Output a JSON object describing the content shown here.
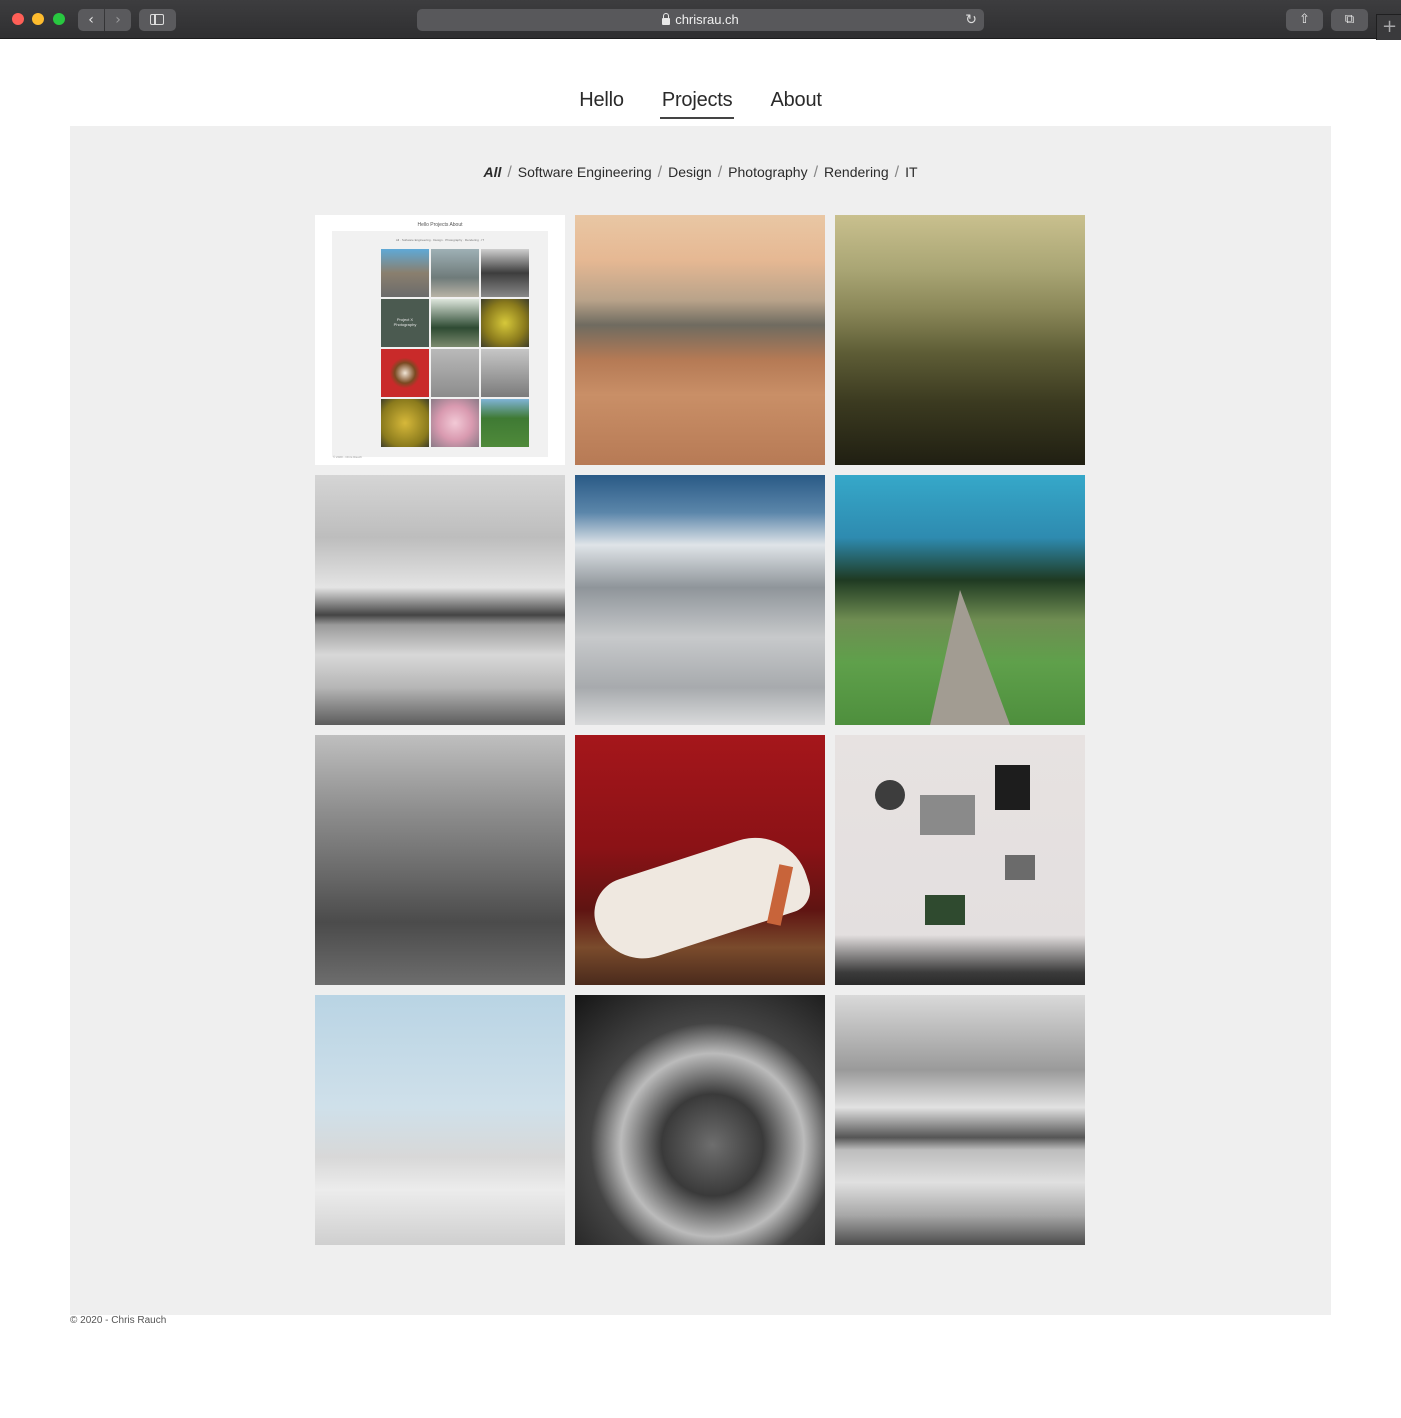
{
  "browser": {
    "url": "chrisrau.ch",
    "back_icon": "‹",
    "forward_icon": "›",
    "reload_icon": "↻",
    "share_icon": "⇧",
    "tabs_icon": "⧉",
    "newtab_icon": "+"
  },
  "nav": {
    "items": [
      {
        "label": "Hello"
      },
      {
        "label": "Projects",
        "active": true
      },
      {
        "label": "About"
      }
    ]
  },
  "filters": [
    {
      "label": "All",
      "active": true
    },
    {
      "label": "Software Engineering"
    },
    {
      "label": "Design"
    },
    {
      "label": "Photography"
    },
    {
      "label": "Rendering"
    },
    {
      "label": "IT"
    }
  ],
  "filter_separator": "/",
  "thumbnail": {
    "nav": "Hello   Projects   About",
    "filters": "All · Software Engineering · Design · Photography · Rendering · IT",
    "project_title": "Project X",
    "project_sub": "Photography",
    "footer": "© 2020 - Chris Rauch"
  },
  "footer": "© 2020 - Chris Rauch"
}
